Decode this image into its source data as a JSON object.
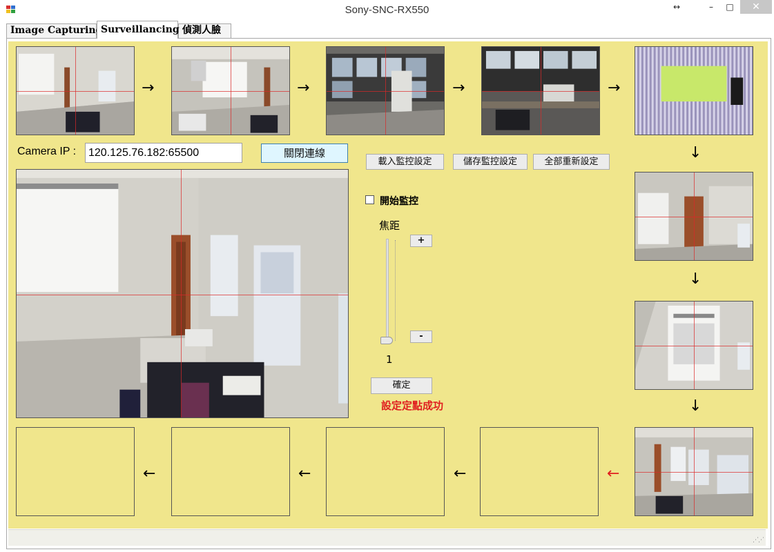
{
  "window": {
    "title": "Sony-SNC-RX550",
    "resize_glyph": "↔",
    "minimize_glyph": "–",
    "maximize_glyph": "□",
    "close_glyph": "✕"
  },
  "tabs": [
    {
      "label": "Image Capturing"
    },
    {
      "label": "Surveillancing"
    },
    {
      "label": "偵測人臉"
    }
  ],
  "connection": {
    "ip_label": "Camera IP :",
    "ip_value": "120.125.76.182:65500",
    "close_button": "關閉連線"
  },
  "settings": {
    "load_button": "載入監控設定",
    "save_button": "儲存監控設定",
    "reset_button": "全部重新設定"
  },
  "monitor": {
    "checkbox_label": "開始監控",
    "checked": false
  },
  "zoom": {
    "label": "焦距",
    "plus": "+",
    "minus": "-",
    "value": "1",
    "slider_level": 0,
    "confirm_button": "確定",
    "status_message": "設定定點成功",
    "status_color": "#e02020"
  },
  "arrows": {
    "right": "→",
    "down": "↓",
    "left": "←",
    "highlight_color": "#e02020"
  },
  "colors": {
    "panel_bg": "#f0e68c",
    "crosshair": "#dc2828"
  }
}
